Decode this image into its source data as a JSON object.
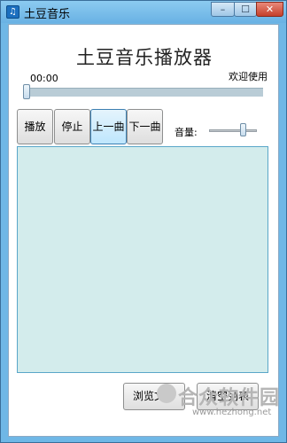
{
  "window": {
    "title": "土豆音乐",
    "icon": "music-note-icon",
    "controls": {
      "minimize": "–",
      "maximize": "☐",
      "close": "✕"
    }
  },
  "header": {
    "app_title": "土豆音乐播放器",
    "time": "00:00",
    "welcome": "欢迎使用"
  },
  "progress": {
    "value_fraction": 0.0
  },
  "controls": {
    "play": "播放",
    "stop": "停止",
    "prev": "上一曲",
    "next": "下一曲",
    "volume_label": "音量:"
  },
  "volume": {
    "value_fraction": 0.75
  },
  "playlist": {
    "items": []
  },
  "footer": {
    "browse": "浏览文件",
    "clear": "清空列表"
  },
  "watermark": {
    "name": "合众软件园",
    "url": "www.hezhong.net"
  },
  "colors": {
    "playlist_bg": "#d3ecec",
    "active_button": "#bee6fd",
    "titlebar": "#6fb7e6"
  }
}
